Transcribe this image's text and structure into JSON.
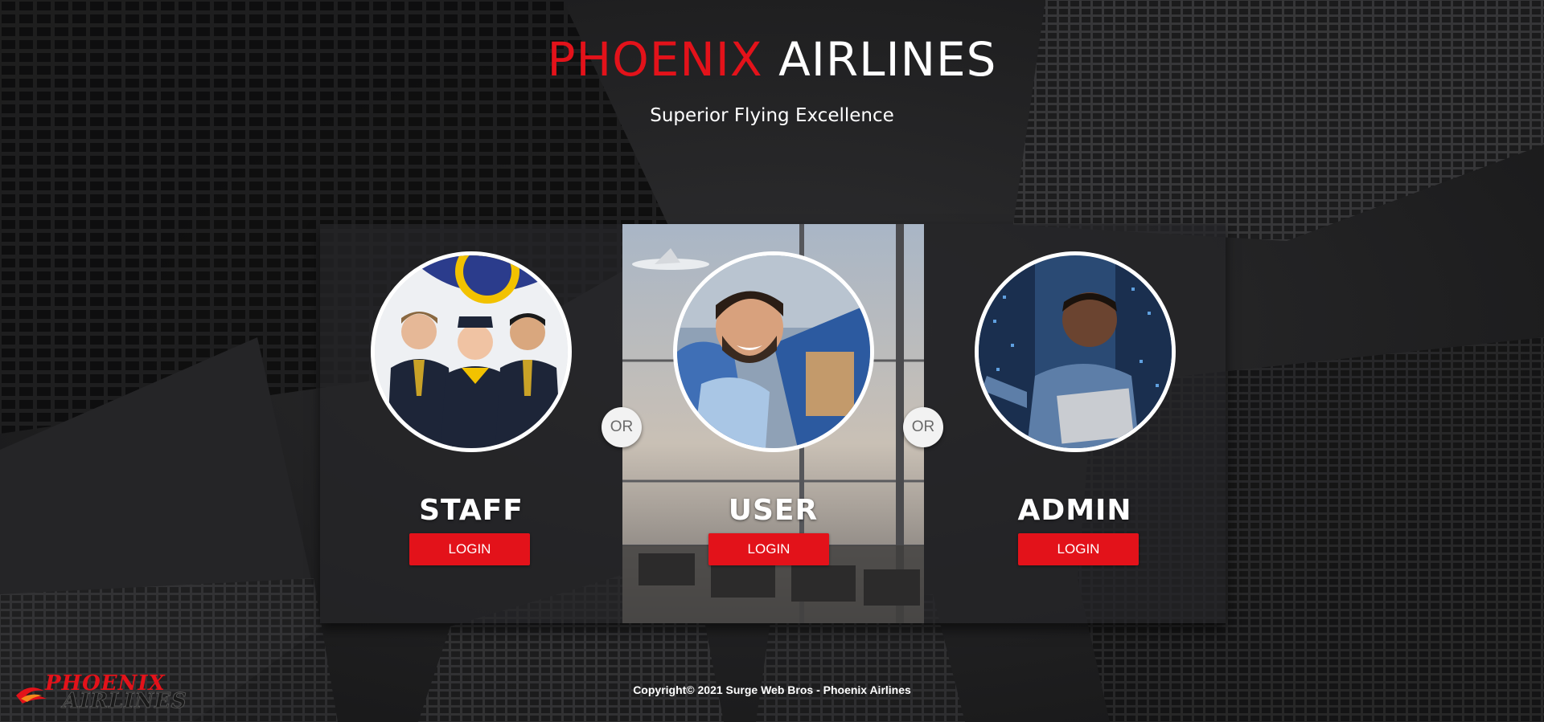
{
  "header": {
    "brand_primary": "PHOENIX",
    "brand_secondary": "AIRLINES",
    "tagline": "Superior Flying Excellence"
  },
  "cards": [
    {
      "role": "STAFF",
      "button_label": "LOGIN"
    },
    {
      "role": "USER",
      "button_label": "LOGIN"
    },
    {
      "role": "ADMIN",
      "button_label": "LOGIN"
    }
  ],
  "separators": [
    "OR",
    "OR"
  ],
  "footer": {
    "copyright": "Copyright© 2021 Surge Web Bros - Phoenix Airlines"
  },
  "logo": {
    "line1": "PHOENIX",
    "line2": "AIRLINES"
  },
  "colors": {
    "accent": "#e3121a",
    "text": "#ffffff",
    "background": "#1e1e1f"
  },
  "icons": [
    "phoenix-bird-logo"
  ]
}
